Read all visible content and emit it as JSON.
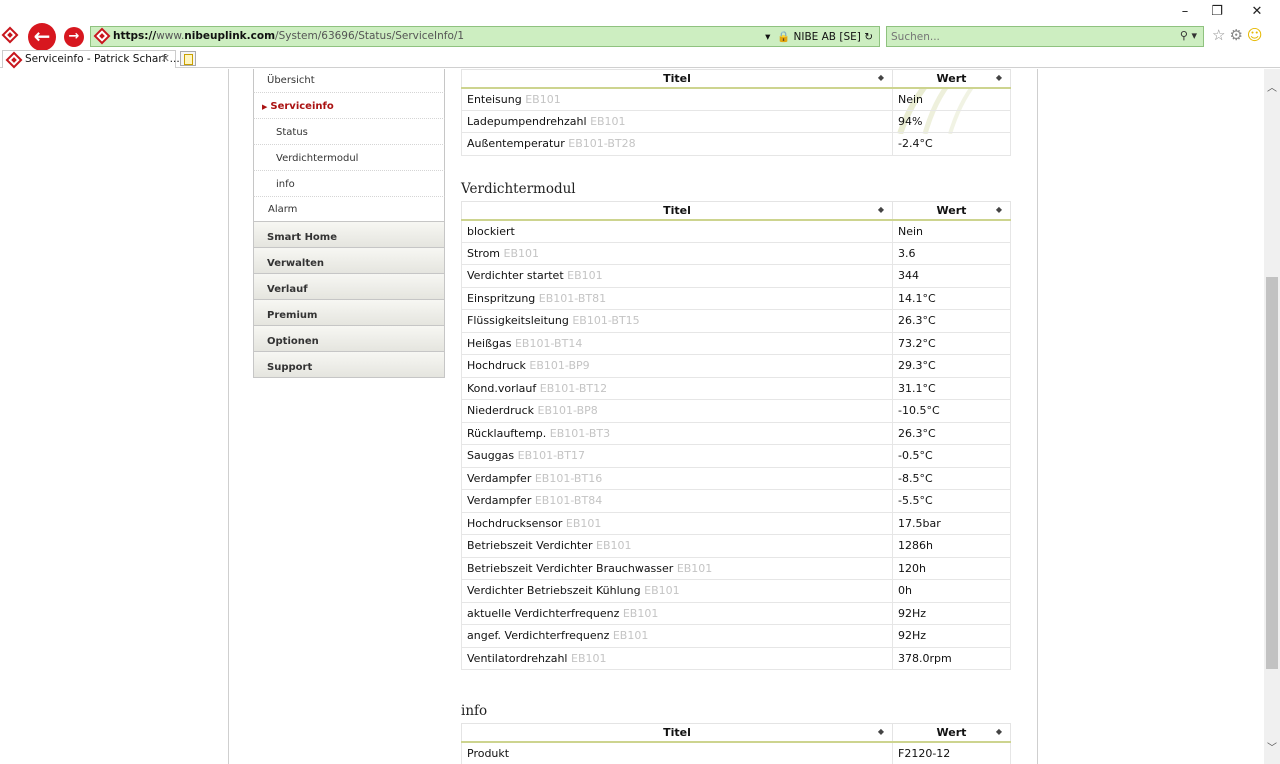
{
  "browser": {
    "url_scheme": "https://",
    "url_host_prefix": "www.",
    "url_host": "nibeuplink.com",
    "url_path": "/System/63696/Status/ServiceInfo/1",
    "security_label": "NIBE AB [SE]",
    "search_placeholder": "Suchen...",
    "tab_title": "Serviceinfo - Patrick Scharf ...",
    "accent_color": "#d7171f",
    "address_bg": "#cdeec1"
  },
  "sidebar": {
    "overview": "Übersicht",
    "serviceinfo": "Serviceinfo",
    "status": "Status",
    "verdichtermodul": "Verdichtermodul",
    "info": "info",
    "alarm": "Alarm",
    "main_items": [
      "Smart Home",
      "Verwalten",
      "Verlauf",
      "Premium",
      "Optionen",
      "Support"
    ]
  },
  "table_headers": {
    "title": "Titel",
    "value": "Wert"
  },
  "top_section": {
    "rows": [
      {
        "label": "Enteisung",
        "code": "EB101",
        "value": "Nein"
      },
      {
        "label": "Ladepumpendrehzahl",
        "code": "EB101",
        "value": "94%"
      },
      {
        "label": "Außentemperatur",
        "code": "EB101-BT28",
        "value": "-2.4°C"
      }
    ]
  },
  "verdichtermodul": {
    "heading": "Verdichtermodul",
    "rows": [
      {
        "label": "blockiert",
        "code": "",
        "value": "Nein"
      },
      {
        "label": "Strom",
        "code": "EB101",
        "value": "3.6"
      },
      {
        "label": "Verdichter startet",
        "code": "EB101",
        "value": "344"
      },
      {
        "label": "Einspritzung",
        "code": "EB101-BT81",
        "value": "14.1°C"
      },
      {
        "label": "Flüssigkeitsleitung",
        "code": "EB101-BT15",
        "value": "26.3°C"
      },
      {
        "label": "Heißgas",
        "code": "EB101-BT14",
        "value": "73.2°C"
      },
      {
        "label": "Hochdruck",
        "code": "EB101-BP9",
        "value": "29.3°C"
      },
      {
        "label": "Kond.vorlauf",
        "code": "EB101-BT12",
        "value": "31.1°C"
      },
      {
        "label": "Niederdruck",
        "code": "EB101-BP8",
        "value": "-10.5°C"
      },
      {
        "label": "Rücklauftemp.",
        "code": "EB101-BT3",
        "value": "26.3°C"
      },
      {
        "label": "Sauggas",
        "code": "EB101-BT17",
        "value": "-0.5°C"
      },
      {
        "label": "Verdampfer",
        "code": "EB101-BT16",
        "value": "-8.5°C"
      },
      {
        "label": "Verdampfer",
        "code": "EB101-BT84",
        "value": "-5.5°C"
      },
      {
        "label": "Hochdrucksensor",
        "code": "EB101",
        "value": "17.5bar"
      },
      {
        "label": "Betriebszeit Verdichter",
        "code": "EB101",
        "value": "1286h"
      },
      {
        "label": "Betriebszeit Verdichter Brauchwasser",
        "code": "EB101",
        "value": "120h"
      },
      {
        "label": "Verdichter Betriebszeit Kühlung",
        "code": "EB101",
        "value": "0h"
      },
      {
        "label": "aktuelle Verdichterfrequenz",
        "code": "EB101",
        "value": "92Hz"
      },
      {
        "label": "angef. Verdichterfrequenz",
        "code": "EB101",
        "value": "92Hz"
      },
      {
        "label": "Ventilatordrehzahl",
        "code": "EB101",
        "value": "378.0rpm"
      }
    ]
  },
  "info_section": {
    "heading": "info",
    "rows": [
      {
        "label": "Produkt",
        "code": "",
        "value": "F2120-12"
      }
    ]
  }
}
